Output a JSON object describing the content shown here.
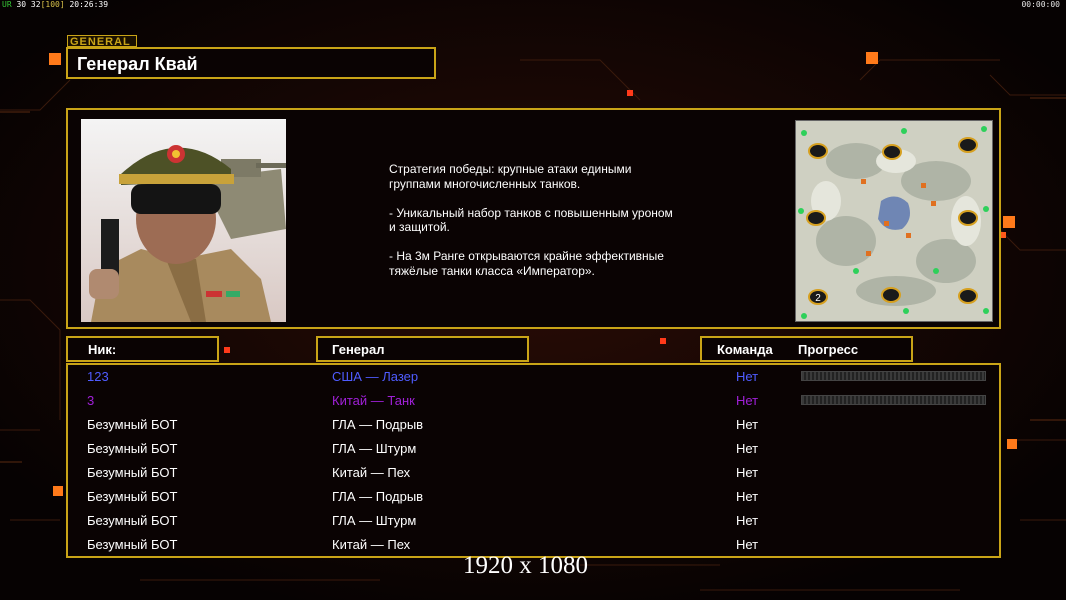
{
  "hud": {
    "left_label": "UR",
    "left_numbers": "30 32",
    "left_bracket": "[100]",
    "left_time": "20:26:39",
    "right_time": "00:00:00"
  },
  "header": {
    "tag": "GENERAL",
    "title": "Генерал Квай"
  },
  "info": {
    "description": "Стратегия победы: крупные атаки едиными\n группами многочисленных танков.\n\n- Уникальный набор танков с повышенным уроном\n и защитой.\n\n- На 3м Ранге открываются крайне эффективные\n тяжёлые танки класса «Император».",
    "map_player_number": "2"
  },
  "table": {
    "col_nick": "Ник:",
    "col_general": "Генерал",
    "col_team": "Команда",
    "col_progress": "Прогресс",
    "rows": [
      {
        "nick": "123",
        "general": "США — Лазер",
        "team": "Нет",
        "color": "#4f5cff",
        "has_progress": true
      },
      {
        "nick": "3",
        "general": "Китай — Танк",
        "team": "Нет",
        "color": "#a020d8",
        "has_progress": true
      },
      {
        "nick": "Безумный БОТ",
        "general": "ГЛА — Подрыв",
        "team": "Нет",
        "color": "#ffffff",
        "has_progress": false
      },
      {
        "nick": "Безумный БОТ",
        "general": "ГЛА — Штурм",
        "team": "Нет",
        "color": "#ffffff",
        "has_progress": false
      },
      {
        "nick": "Безумный БОТ",
        "general": "Китай — Пех",
        "team": "Нет",
        "color": "#ffffff",
        "has_progress": false
      },
      {
        "nick": "Безумный БОТ",
        "general": "ГЛА — Подрыв",
        "team": "Нет",
        "color": "#ffffff",
        "has_progress": false
      },
      {
        "nick": "Безумный БОТ",
        "general": "ГЛА — Штурм",
        "team": "Нет",
        "color": "#ffffff",
        "has_progress": false
      },
      {
        "nick": "Безумный БОТ",
        "general": "Китай — Пех",
        "team": "Нет",
        "color": "#ffffff",
        "has_progress": false
      }
    ]
  },
  "footer": {
    "resolution": "1920 x 1080"
  },
  "colors": {
    "accent_gold": "#c9a417",
    "orange": "#ff7a1a",
    "usa_blue": "#4f5cff",
    "china_purple": "#a020d8"
  }
}
